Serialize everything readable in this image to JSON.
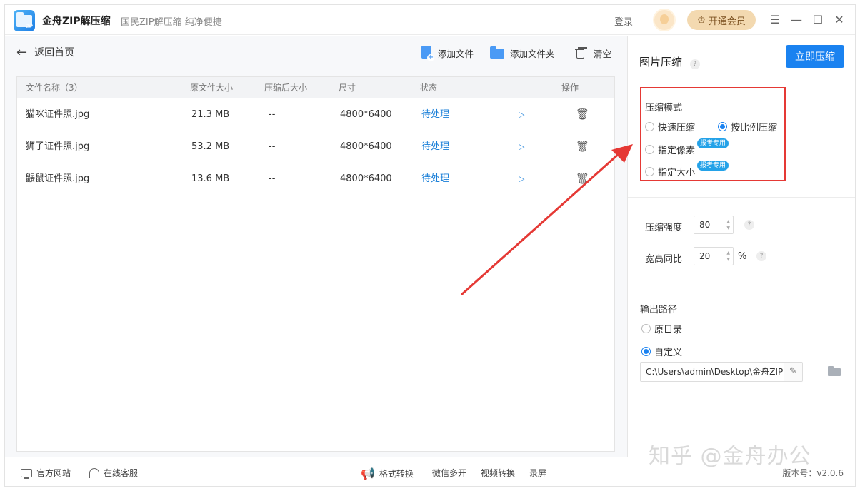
{
  "app": {
    "name": "金舟ZIP解压缩",
    "slogan": "国民ZIP解压缩  纯净便捷",
    "login": "登录",
    "vip": "开通会员"
  },
  "toolbar": {
    "back": "返回首页",
    "add_file": "添加文件",
    "add_folder": "添加文件夹",
    "clear": "清空"
  },
  "table": {
    "headers": [
      "文件名称（3）",
      "原文件大小",
      "压缩后大小",
      "尺寸",
      "状态",
      "操作"
    ],
    "rows": [
      {
        "name": "猫咪证件照.jpg",
        "size": "21.3 MB",
        "compressed": "--",
        "dims": "4800*6400",
        "status": "待处理"
      },
      {
        "name": "狮子证件照.jpg",
        "size": "53.2 MB",
        "compressed": "--",
        "dims": "4800*6400",
        "status": "待处理"
      },
      {
        "name": "鼹鼠证件照.jpg",
        "size": "13.6 MB",
        "compressed": "--",
        "dims": "4800*6400",
        "status": "待处理"
      }
    ]
  },
  "panel": {
    "title": "图片压缩",
    "help": "?",
    "compress_now": "立即压缩",
    "mode_label": "压缩模式",
    "modes": {
      "fast": "快速压缩",
      "ratio": "按比例压缩",
      "pixel": "指定像素",
      "size": "指定大小"
    },
    "badge": "报考专用",
    "strength_label": "压缩强度",
    "strength_value": "80",
    "ratio_label": "宽高同比",
    "ratio_value": "20",
    "ratio_unit": "%",
    "output_label": "输出路径",
    "output_original": "原目录",
    "output_custom": "自定义",
    "output_path": "C:\\Users\\admin\\Desktop\\金舟ZIP解压"
  },
  "footer": {
    "website": "官方网站",
    "support": "在线客服",
    "format": "格式转换",
    "wechat": "微信多开",
    "video": "视频转换",
    "record": "录屏",
    "version": "版本号：v2.0.6"
  },
  "watermark": "知乎 @金舟办公",
  "colors": {
    "accent": "#1a82f0",
    "highlight_box": "#e53935",
    "badge": "#24a2e8"
  }
}
